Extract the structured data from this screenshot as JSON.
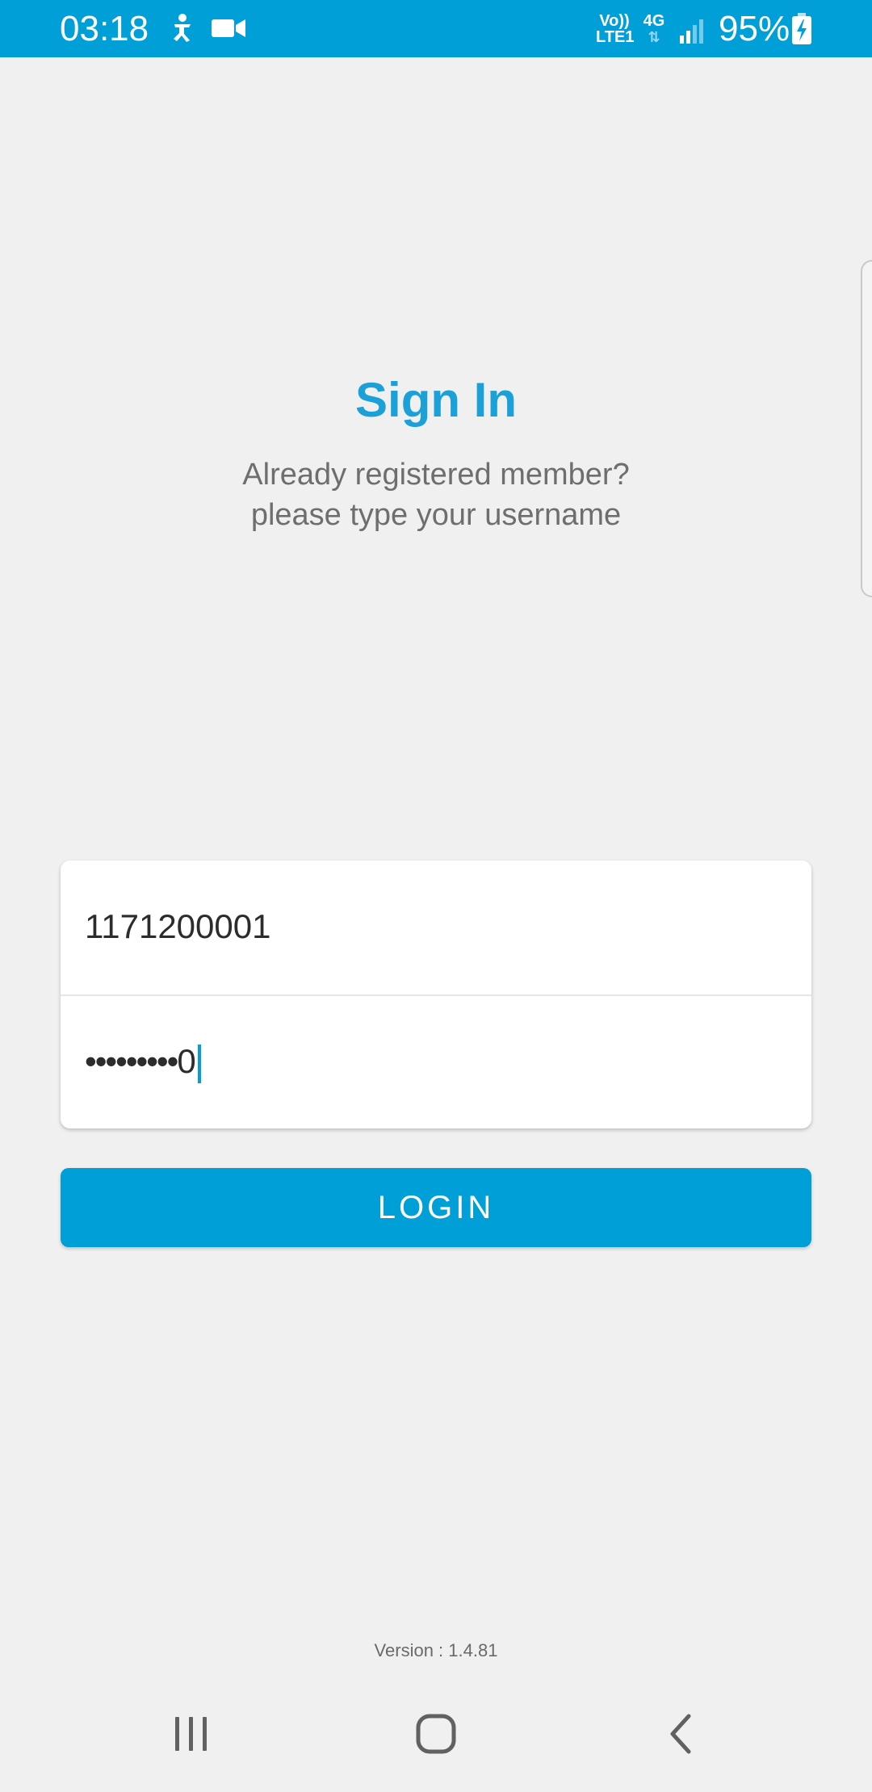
{
  "status_bar": {
    "time": "03:18",
    "network_volte": "Vo))",
    "network_lte": "LTE1",
    "network_type": "4G",
    "battery_percent": "95%",
    "background_color": "#019fd8",
    "icons": [
      "accessibility-icon",
      "video-camera-icon",
      "signal-icon",
      "battery-charging-icon"
    ]
  },
  "header": {
    "title": "Sign In",
    "subtitle_line1": "Already registered member?",
    "subtitle_line2": "please type your username"
  },
  "form": {
    "username_value": "1171200001",
    "password_masked": "•••••••••",
    "password_last_char": "0"
  },
  "login_button": {
    "label": "LOGIN",
    "color": "#019fd8"
  },
  "footer": {
    "version": "Version : 1.4.81"
  },
  "nav_bar": {
    "buttons": [
      "recent-apps-icon",
      "home-icon",
      "back-icon"
    ]
  }
}
